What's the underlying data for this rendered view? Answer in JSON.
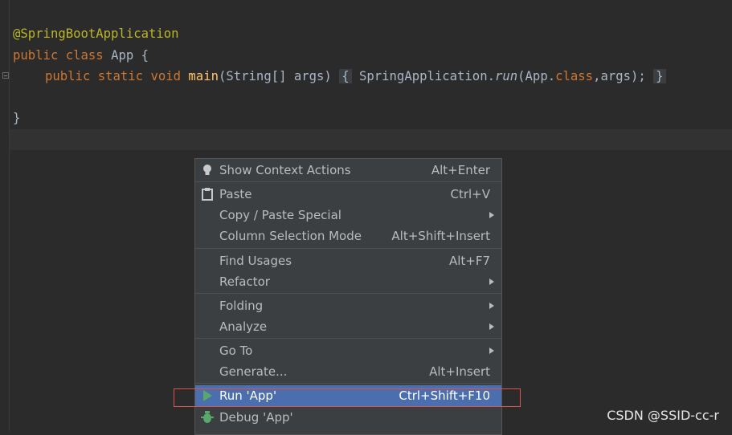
{
  "editor": {
    "line1": "@SpringBootApplication",
    "line2": {
      "kw_public": "public",
      "kw_class": "class",
      "name": "App",
      "brace": "{"
    },
    "line3": {
      "kw_public": "public",
      "kw_static": "static",
      "kw_void": "void",
      "method": "main",
      "params": "(String[] args)",
      "open_brace": "{",
      "call_prefix": "SpringApplication.",
      "call_method": "run",
      "call_args_prefix": "(App.",
      "kw_class": "class",
      "call_args_suffix": ",args);",
      "close_brace": "}"
    },
    "line5": "}"
  },
  "menu": {
    "items": [
      {
        "label": "Show Context Actions",
        "shortcut": "Alt+Enter",
        "icon": "lightbulb-icon"
      },
      {
        "label": "Paste",
        "shortcut": "Ctrl+V",
        "icon": "clipboard-icon"
      },
      {
        "label": "Copy / Paste Special",
        "submenu": true
      },
      {
        "label": "Column Selection Mode",
        "shortcut": "Alt+Shift+Insert"
      },
      {
        "label": "Find Usages",
        "shortcut": "Alt+F7"
      },
      {
        "label": "Refactor",
        "submenu": true
      },
      {
        "label": "Folding",
        "submenu": true
      },
      {
        "label": "Analyze",
        "submenu": true
      },
      {
        "label": "Go To",
        "submenu": true
      },
      {
        "label": "Generate...",
        "shortcut": "Alt+Insert"
      },
      {
        "label": "Run 'App'",
        "shortcut": "Ctrl+Shift+F10",
        "icon": "run-icon",
        "selected": true
      },
      {
        "label": "Debug 'App'",
        "icon": "debug-icon"
      }
    ]
  },
  "watermark": "CSDN @SSID-cc-r",
  "colors": {
    "background": "#2b2b2b",
    "keyword": "#cc7832",
    "annotation": "#bbb529",
    "method": "#ffc66d",
    "text": "#a9b7c6",
    "menu_bg": "#3c3f41",
    "selection": "#4b6eaf",
    "highlight_box": "#d9534f"
  }
}
